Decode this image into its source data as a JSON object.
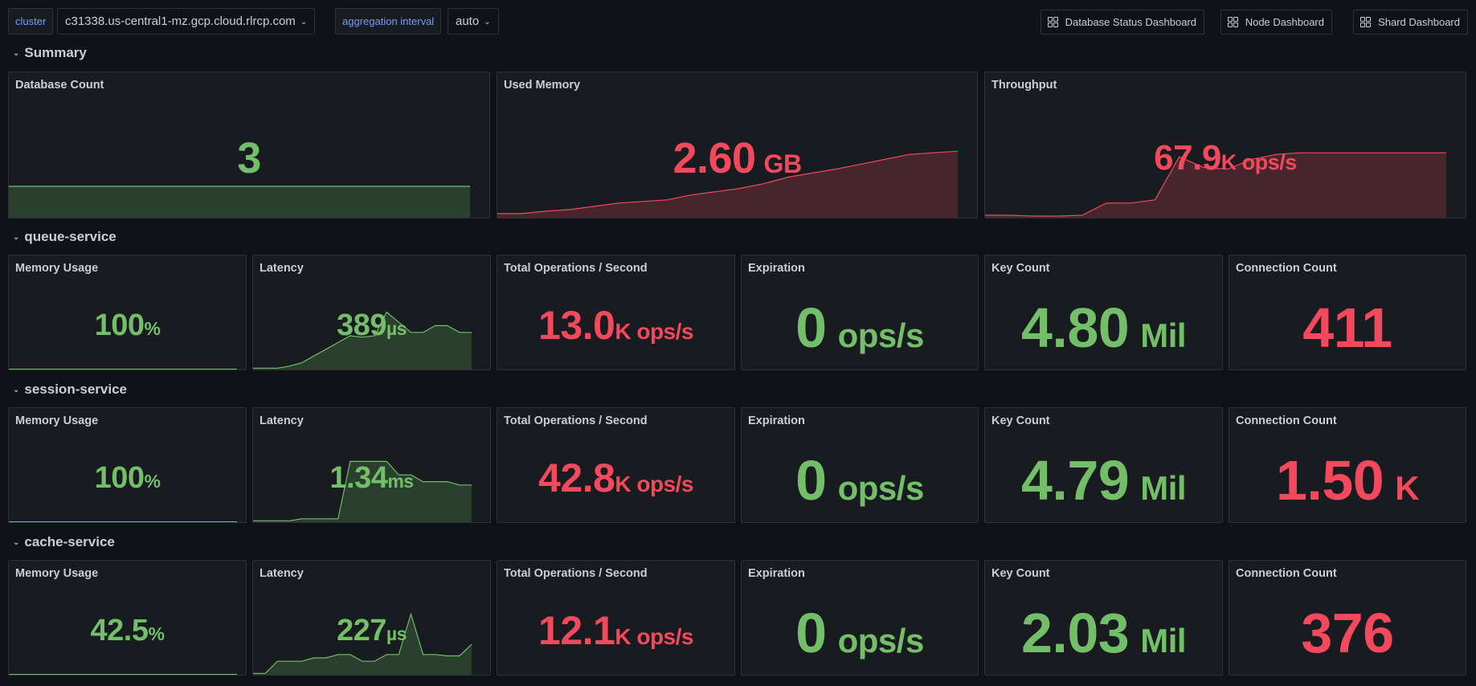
{
  "variables": {
    "cluster_label": "cluster",
    "cluster_value": "c31338.us-central1-mz.gcp.cloud.rlrcp.com",
    "interval_label": "aggregation interval",
    "interval_value": "auto"
  },
  "links": {
    "database_status": "Database Status Dashboard",
    "node": "Node Dashboard",
    "shard": "Shard Dashboard"
  },
  "colors": {
    "green": "#73bf69",
    "red": "#f2495c",
    "background": "#111217",
    "panel": "#181b1f"
  },
  "summary": {
    "title": "Summary",
    "database_count": {
      "title": "Database Count",
      "value": "3",
      "color": "green",
      "sparkline": [
        1,
        1,
        1,
        1,
        1,
        1,
        1,
        1,
        1,
        1,
        1,
        1,
        1,
        1,
        1,
        1,
        1,
        1,
        1,
        1
      ]
    },
    "used_memory": {
      "title": "Used Memory",
      "value": "2.60",
      "unit": "GB",
      "color": "red",
      "sparkline": [
        0.05,
        0.05,
        0.08,
        0.1,
        0.14,
        0.18,
        0.2,
        0.22,
        0.28,
        0.32,
        0.36,
        0.42,
        0.5,
        0.55,
        0.6,
        0.66,
        0.72,
        0.78,
        0.8,
        0.82
      ]
    },
    "throughput": {
      "title": "Throughput",
      "value": "67.9",
      "unit": "K ops/s",
      "color": "red",
      "sparkline": [
        0.03,
        0.03,
        0.02,
        0.02,
        0.03,
        0.18,
        0.18,
        0.22,
        0.75,
        0.62,
        0.6,
        0.72,
        0.78,
        0.8,
        0.8,
        0.8,
        0.8,
        0.8,
        0.8,
        0.8
      ]
    }
  },
  "services": [
    {
      "name": "queue-service",
      "memory_usage": {
        "title": "Memory Usage",
        "value": "100",
        "unit": "%",
        "color": "green"
      },
      "latency": {
        "title": "Latency",
        "value": "389",
        "unit": "µs",
        "color": "green",
        "sparkline": [
          0.02,
          0.02,
          0.02,
          0.05,
          0.1,
          0.2,
          0.3,
          0.4,
          0.5,
          0.48,
          0.5,
          0.85,
          0.7,
          0.55,
          0.55,
          0.65,
          0.65,
          0.55,
          0.55
        ]
      },
      "total_ops": {
        "title": "Total Operations / Second",
        "value": "13.0",
        "unit": "K ops/s",
        "color": "red"
      },
      "expiration": {
        "title": "Expiration",
        "value": "0",
        "unit": "ops/s",
        "color": "green"
      },
      "key_count": {
        "title": "Key Count",
        "value": "4.80",
        "unit": "Mil",
        "color": "green"
      },
      "connection_count": {
        "title": "Connection Count",
        "value": "411",
        "unit": "",
        "color": "red"
      }
    },
    {
      "name": "session-service",
      "memory_usage": {
        "title": "Memory Usage",
        "value": "100",
        "unit": "%",
        "color": "green"
      },
      "latency": {
        "title": "Latency",
        "value": "1.34",
        "unit": "ms",
        "color": "green",
        "sparkline": [
          0.02,
          0.02,
          0.02,
          0.02,
          0.05,
          0.05,
          0.05,
          0.05,
          0.9,
          0.9,
          0.9,
          0.9,
          0.7,
          0.7,
          0.6,
          0.6,
          0.6,
          0.55,
          0.55
        ]
      },
      "total_ops": {
        "title": "Total Operations / Second",
        "value": "42.8",
        "unit": "K ops/s",
        "color": "red"
      },
      "expiration": {
        "title": "Expiration",
        "value": "0",
        "unit": "ops/s",
        "color": "green"
      },
      "key_count": {
        "title": "Key Count",
        "value": "4.79",
        "unit": "Mil",
        "color": "green"
      },
      "connection_count": {
        "title": "Connection Count",
        "value": "1.50",
        "unit": "K",
        "color": "red"
      }
    },
    {
      "name": "cache-service",
      "memory_usage": {
        "title": "Memory Usage",
        "value": "42.5",
        "unit": "%",
        "color": "green"
      },
      "latency": {
        "title": "Latency",
        "value": "227",
        "unit": "µs",
        "color": "green",
        "sparkline": [
          0.02,
          0.02,
          0.2,
          0.2,
          0.2,
          0.25,
          0.25,
          0.3,
          0.3,
          0.2,
          0.2,
          0.3,
          0.3,
          0.9,
          0.3,
          0.3,
          0.28,
          0.28,
          0.45
        ]
      },
      "total_ops": {
        "title": "Total Operations / Second",
        "value": "12.1",
        "unit": "K ops/s",
        "color": "red"
      },
      "expiration": {
        "title": "Expiration",
        "value": "0",
        "unit": "ops/s",
        "color": "green"
      },
      "key_count": {
        "title": "Key Count",
        "value": "2.03",
        "unit": "Mil",
        "color": "green"
      },
      "connection_count": {
        "title": "Connection Count",
        "value": "376",
        "unit": "",
        "color": "red"
      }
    }
  ]
}
